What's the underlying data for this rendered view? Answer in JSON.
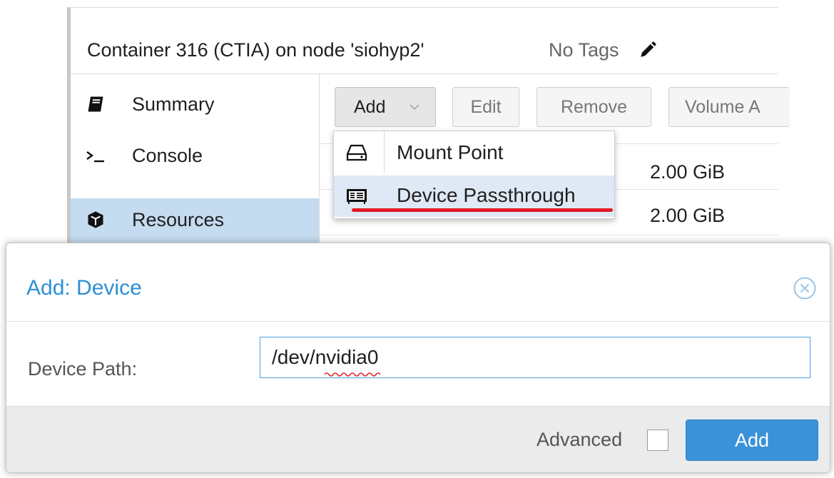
{
  "panel": {
    "title": "Container 316 (CTIA) on node 'siohyp2'",
    "tags_label": "No Tags",
    "tags_edit_icon": "pencil-icon"
  },
  "sidebar": {
    "items": [
      {
        "label": "Summary",
        "icon": "book-icon",
        "active": false
      },
      {
        "label": "Console",
        "icon": "terminal-icon",
        "active": false
      },
      {
        "label": "Resources",
        "icon": "cube-icon",
        "active": true
      }
    ]
  },
  "toolbar": {
    "add_label": "Add",
    "edit_label": "Edit",
    "remove_label": "Remove",
    "volume_label": "Volume A"
  },
  "resources": {
    "rows": [
      {
        "value": "2.00 GiB"
      },
      {
        "value": "2.00 GiB"
      }
    ]
  },
  "add_menu": {
    "items": [
      {
        "label": "Mount Point",
        "icon": "hdd-icon"
      },
      {
        "label": "Device Passthrough",
        "icon": "device-card-icon",
        "highlighted": true
      }
    ]
  },
  "dialog": {
    "title": "Add: Device",
    "close_icon": "close-circle-icon",
    "device_path_label": "Device Path:",
    "device_path_value": "/dev/nvidia0",
    "advanced_label": "Advanced",
    "advanced_checked": false,
    "add_button_label": "Add"
  },
  "colors": {
    "accent": "#2c8fd6",
    "primary_button": "#3a92d8",
    "active_nav": "#c5dbef",
    "menu_hover": "#dfe9f5",
    "annotation_underline": "#e21a26"
  }
}
